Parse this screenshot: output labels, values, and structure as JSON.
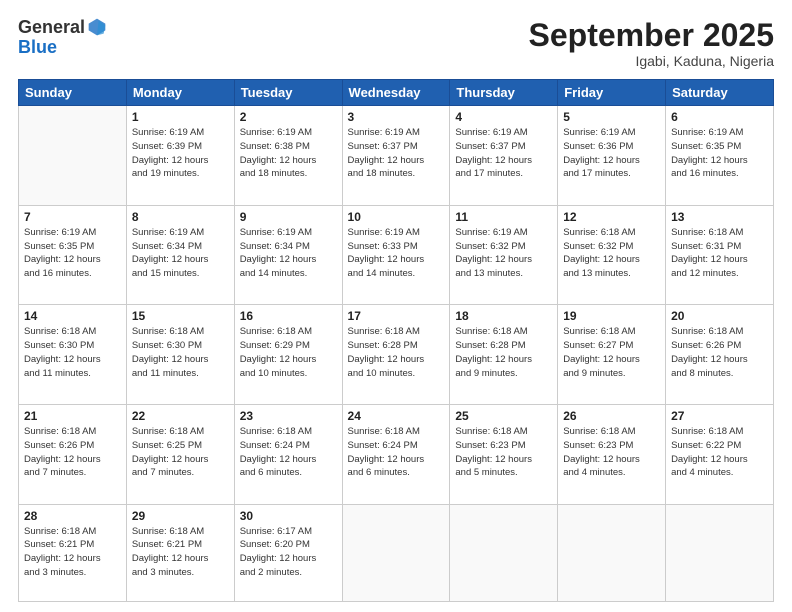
{
  "header": {
    "logo_general": "General",
    "logo_blue": "Blue",
    "month": "September 2025",
    "location": "Igabi, Kaduna, Nigeria"
  },
  "days_of_week": [
    "Sunday",
    "Monday",
    "Tuesday",
    "Wednesday",
    "Thursday",
    "Friday",
    "Saturday"
  ],
  "weeks": [
    [
      {
        "num": "",
        "info": ""
      },
      {
        "num": "1",
        "info": "Sunrise: 6:19 AM\nSunset: 6:39 PM\nDaylight: 12 hours\nand 19 minutes."
      },
      {
        "num": "2",
        "info": "Sunrise: 6:19 AM\nSunset: 6:38 PM\nDaylight: 12 hours\nand 18 minutes."
      },
      {
        "num": "3",
        "info": "Sunrise: 6:19 AM\nSunset: 6:37 PM\nDaylight: 12 hours\nand 18 minutes."
      },
      {
        "num": "4",
        "info": "Sunrise: 6:19 AM\nSunset: 6:37 PM\nDaylight: 12 hours\nand 17 minutes."
      },
      {
        "num": "5",
        "info": "Sunrise: 6:19 AM\nSunset: 6:36 PM\nDaylight: 12 hours\nand 17 minutes."
      },
      {
        "num": "6",
        "info": "Sunrise: 6:19 AM\nSunset: 6:35 PM\nDaylight: 12 hours\nand 16 minutes."
      }
    ],
    [
      {
        "num": "7",
        "info": "Sunrise: 6:19 AM\nSunset: 6:35 PM\nDaylight: 12 hours\nand 16 minutes."
      },
      {
        "num": "8",
        "info": "Sunrise: 6:19 AM\nSunset: 6:34 PM\nDaylight: 12 hours\nand 15 minutes."
      },
      {
        "num": "9",
        "info": "Sunrise: 6:19 AM\nSunset: 6:34 PM\nDaylight: 12 hours\nand 14 minutes."
      },
      {
        "num": "10",
        "info": "Sunrise: 6:19 AM\nSunset: 6:33 PM\nDaylight: 12 hours\nand 14 minutes."
      },
      {
        "num": "11",
        "info": "Sunrise: 6:19 AM\nSunset: 6:32 PM\nDaylight: 12 hours\nand 13 minutes."
      },
      {
        "num": "12",
        "info": "Sunrise: 6:18 AM\nSunset: 6:32 PM\nDaylight: 12 hours\nand 13 minutes."
      },
      {
        "num": "13",
        "info": "Sunrise: 6:18 AM\nSunset: 6:31 PM\nDaylight: 12 hours\nand 12 minutes."
      }
    ],
    [
      {
        "num": "14",
        "info": "Sunrise: 6:18 AM\nSunset: 6:30 PM\nDaylight: 12 hours\nand 11 minutes."
      },
      {
        "num": "15",
        "info": "Sunrise: 6:18 AM\nSunset: 6:30 PM\nDaylight: 12 hours\nand 11 minutes."
      },
      {
        "num": "16",
        "info": "Sunrise: 6:18 AM\nSunset: 6:29 PM\nDaylight: 12 hours\nand 10 minutes."
      },
      {
        "num": "17",
        "info": "Sunrise: 6:18 AM\nSunset: 6:28 PM\nDaylight: 12 hours\nand 10 minutes."
      },
      {
        "num": "18",
        "info": "Sunrise: 6:18 AM\nSunset: 6:28 PM\nDaylight: 12 hours\nand 9 minutes."
      },
      {
        "num": "19",
        "info": "Sunrise: 6:18 AM\nSunset: 6:27 PM\nDaylight: 12 hours\nand 9 minutes."
      },
      {
        "num": "20",
        "info": "Sunrise: 6:18 AM\nSunset: 6:26 PM\nDaylight: 12 hours\nand 8 minutes."
      }
    ],
    [
      {
        "num": "21",
        "info": "Sunrise: 6:18 AM\nSunset: 6:26 PM\nDaylight: 12 hours\nand 7 minutes."
      },
      {
        "num": "22",
        "info": "Sunrise: 6:18 AM\nSunset: 6:25 PM\nDaylight: 12 hours\nand 7 minutes."
      },
      {
        "num": "23",
        "info": "Sunrise: 6:18 AM\nSunset: 6:24 PM\nDaylight: 12 hours\nand 6 minutes."
      },
      {
        "num": "24",
        "info": "Sunrise: 6:18 AM\nSunset: 6:24 PM\nDaylight: 12 hours\nand 6 minutes."
      },
      {
        "num": "25",
        "info": "Sunrise: 6:18 AM\nSunset: 6:23 PM\nDaylight: 12 hours\nand 5 minutes."
      },
      {
        "num": "26",
        "info": "Sunrise: 6:18 AM\nSunset: 6:23 PM\nDaylight: 12 hours\nand 4 minutes."
      },
      {
        "num": "27",
        "info": "Sunrise: 6:18 AM\nSunset: 6:22 PM\nDaylight: 12 hours\nand 4 minutes."
      }
    ],
    [
      {
        "num": "28",
        "info": "Sunrise: 6:18 AM\nSunset: 6:21 PM\nDaylight: 12 hours\nand 3 minutes."
      },
      {
        "num": "29",
        "info": "Sunrise: 6:18 AM\nSunset: 6:21 PM\nDaylight: 12 hours\nand 3 minutes."
      },
      {
        "num": "30",
        "info": "Sunrise: 6:17 AM\nSunset: 6:20 PM\nDaylight: 12 hours\nand 2 minutes."
      },
      {
        "num": "",
        "info": ""
      },
      {
        "num": "",
        "info": ""
      },
      {
        "num": "",
        "info": ""
      },
      {
        "num": "",
        "info": ""
      }
    ]
  ]
}
